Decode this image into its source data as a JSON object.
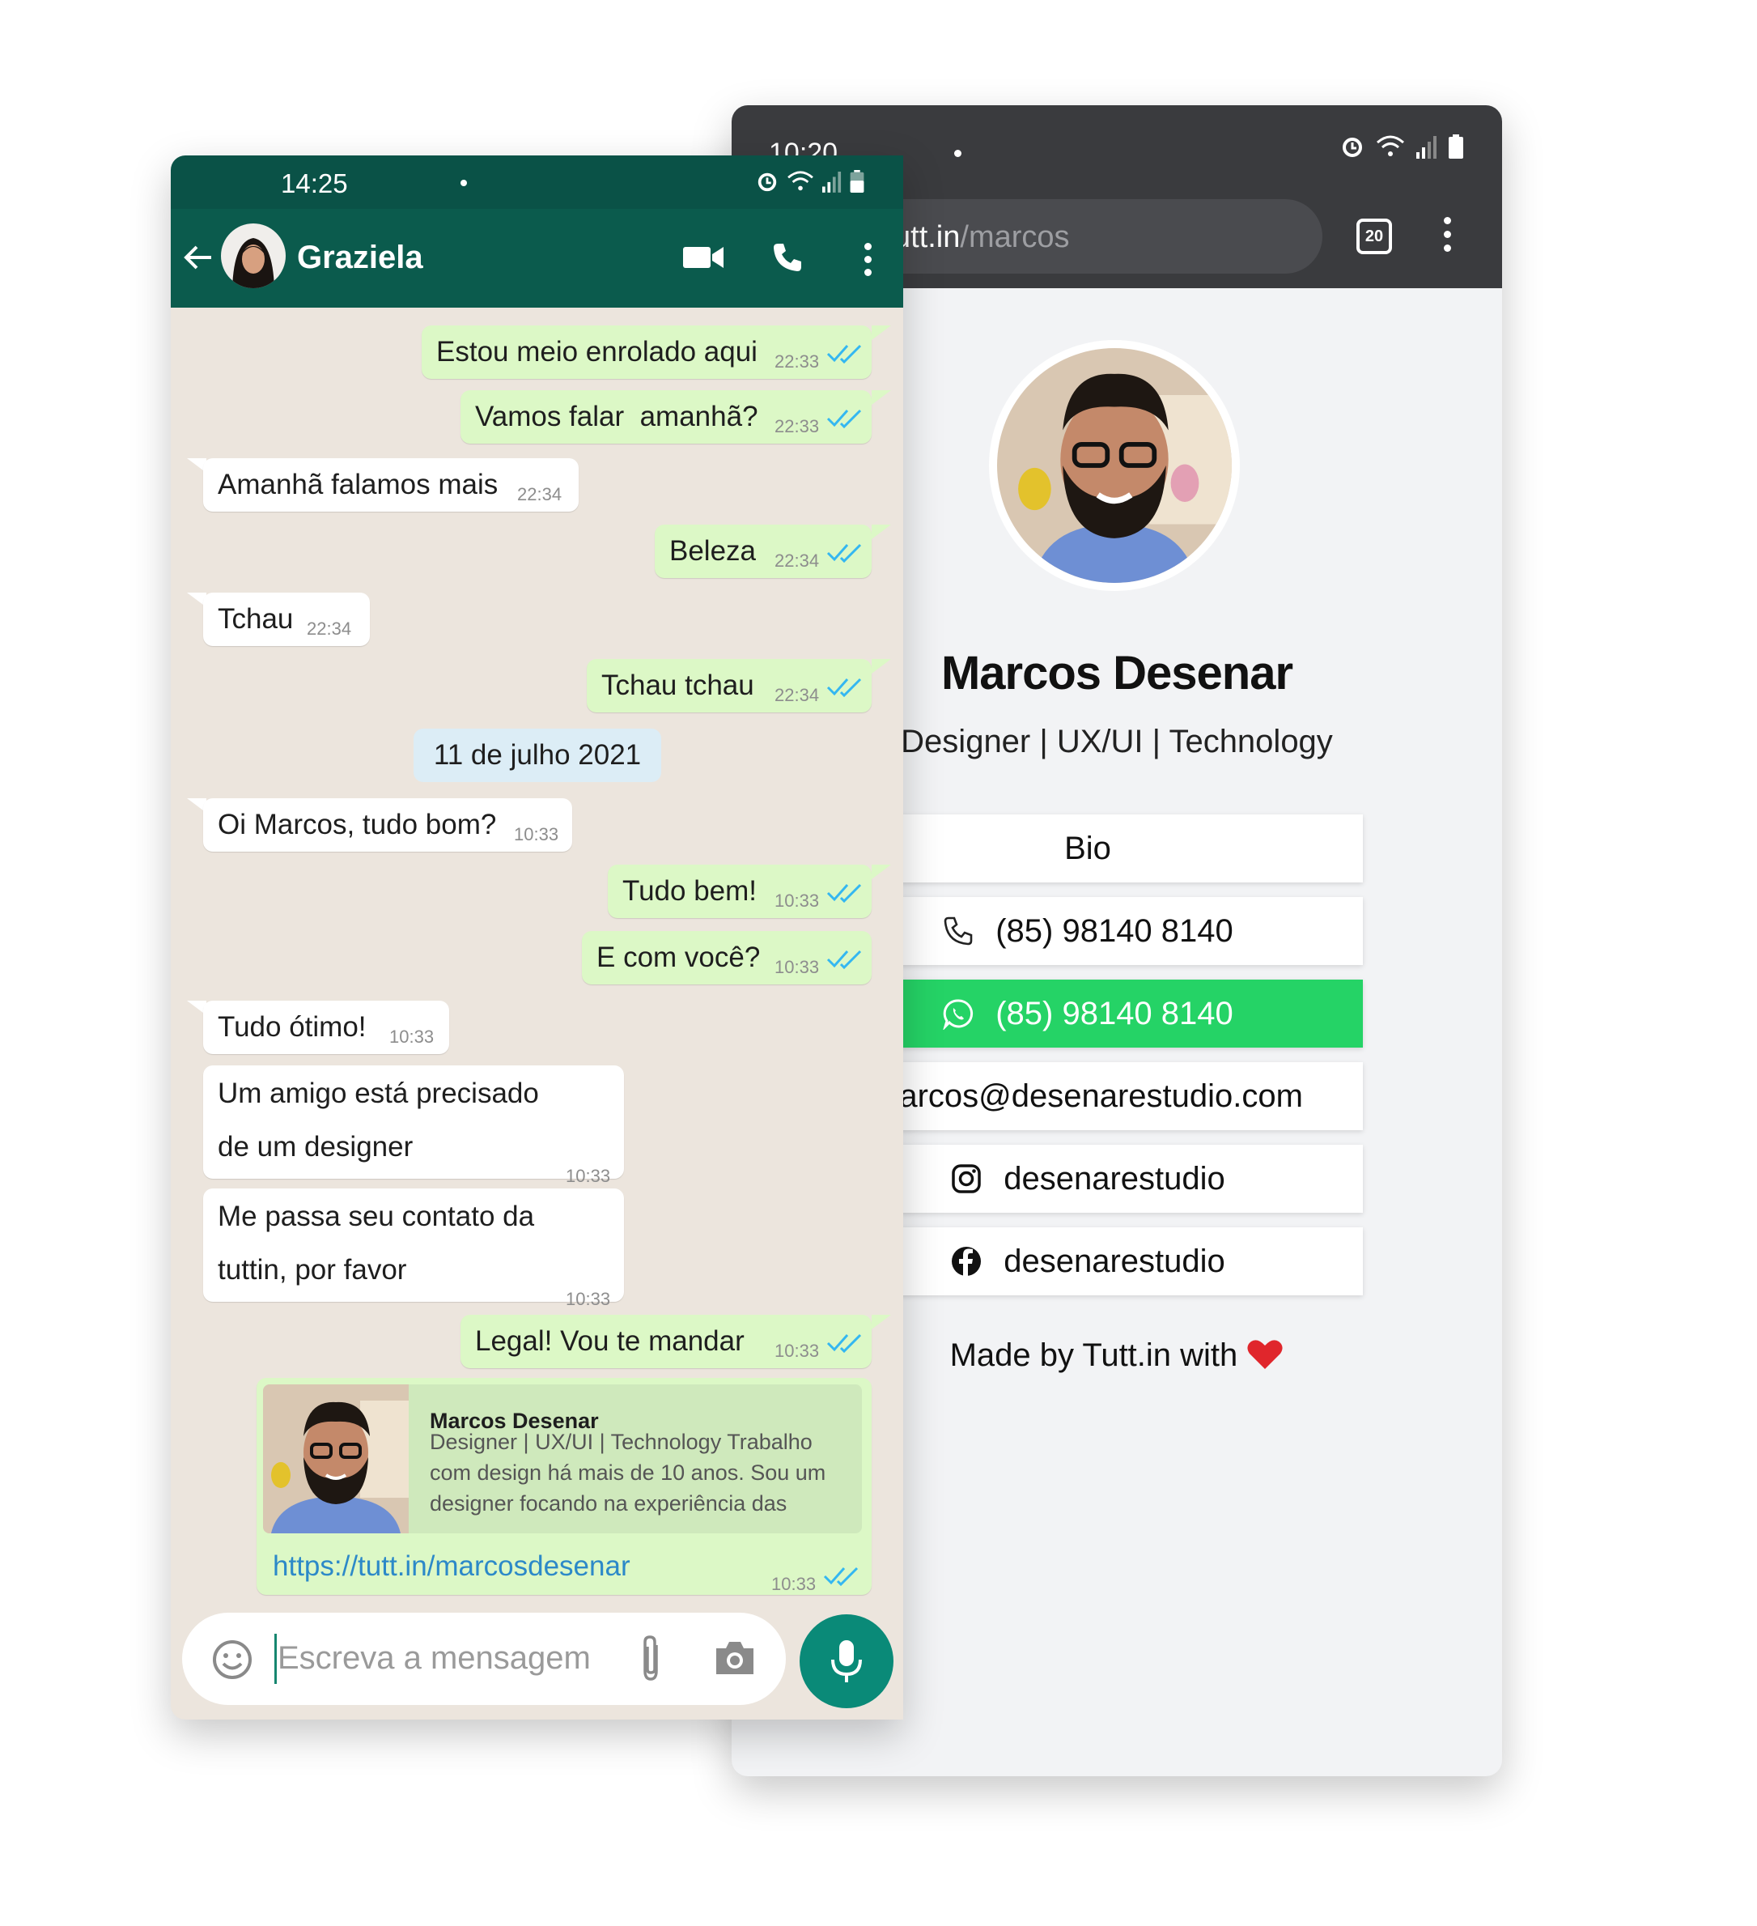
{
  "browser": {
    "status_time": "10:20",
    "url_host": "utt.in",
    "url_path": "/marcos",
    "tab_count": "20",
    "profile": {
      "name": "Marcos Desenar",
      "bio": "Designer | UX/UI | Technology"
    },
    "links": [
      {
        "label": "Bio",
        "icon": "none"
      },
      {
        "label": "(85) 98140 8140",
        "icon": "phone-icon"
      },
      {
        "label": "(85) 98140 8140",
        "icon": "whatsapp-icon"
      },
      {
        "label": "marcos@desenarestudio.com",
        "icon": "none"
      },
      {
        "label": "desenarestudio",
        "icon": "instagram-icon"
      },
      {
        "label": "desenarestudio",
        "icon": "facebook-icon"
      }
    ],
    "footer": "Made by Tutt.in with",
    "colors": {
      "toolbar": "#3a3b3e",
      "whatsapp_button": "#25d366"
    }
  },
  "whatsapp": {
    "status_time": "14:25",
    "contact_name": "Graziela",
    "messages": [
      {
        "dir": "out",
        "text": "Estou meio enrolado aqui",
        "time": "22:33"
      },
      {
        "dir": "out",
        "text": "Vamos falar  amanhã?",
        "time": "22:33"
      },
      {
        "dir": "in",
        "text": "Amanhã falamos mais",
        "time": "22:34"
      },
      {
        "dir": "out",
        "text": "Beleza",
        "time": "22:34"
      },
      {
        "dir": "in",
        "text": "Tchau",
        "time": "22:34"
      },
      {
        "dir": "out",
        "text": "Tchau tchau",
        "time": "22:34"
      },
      {
        "dir": "out",
        "text": "Tudo bem!",
        "time": "10:33"
      },
      {
        "dir": "out",
        "text": "E com você?",
        "time": "10:33"
      },
      {
        "dir": "in",
        "text": "Oi Marcos, tudo bom?",
        "time": "10:33"
      },
      {
        "dir": "in",
        "text": "Tudo ótimo!",
        "time": "10:33"
      },
      {
        "dir": "in",
        "text_line1": "Um amigo está precisado",
        "text_line2": "de um designer",
        "time": "10:33"
      },
      {
        "dir": "in",
        "text_line1": "Me passa seu contato da",
        "text_line2": "tuttin, por favor",
        "time": "10:33"
      },
      {
        "dir": "out",
        "text": "Legal! Vou te mandar",
        "time": "10:33"
      }
    ],
    "date_divider": "11 de julho 2021",
    "link_preview": {
      "title": "Marcos Desenar",
      "description": "Designer | UX/UI | Technology Trabalho com design há mais de 10 anos. Sou um designer focando na experiência das",
      "url": "https://tutt.in/marcosdesenar",
      "time": "10:33"
    },
    "input_placeholder": "Escreva a mensagem",
    "colors": {
      "header": "#0b5b4d",
      "outgoing": "#dcf8c6",
      "incoming": "#ffffff",
      "ticks": "#34b7f1"
    }
  }
}
